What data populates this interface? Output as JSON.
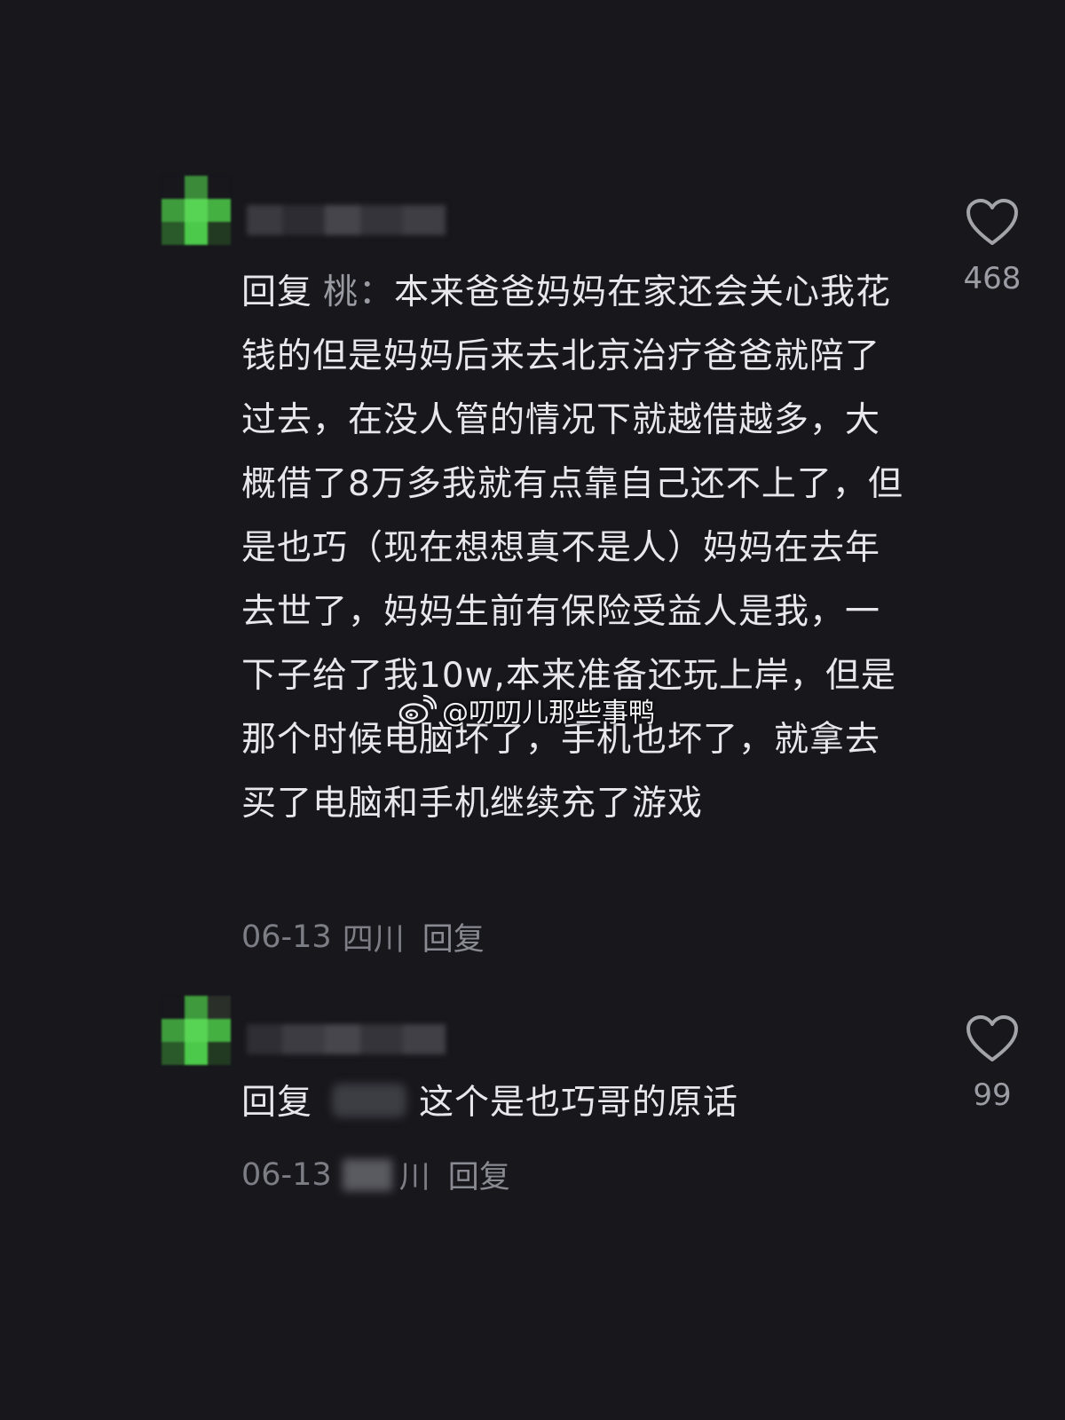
{
  "comments": [
    {
      "reply_prefix": "回复",
      "reply_target": "桃：",
      "text": "本来爸爸妈妈在家还会关心我花钱的但是妈妈后来去北京治疗爸爸就陪了过去，在没人管的情况下就越借越多，大概借了8万多我就有点靠自己还不上了，但是也巧（现在想想真不是人）妈妈在去年去世了，妈妈生前有保险受益人是我，一下子给了我10w,本来准备还玩上岸，但是那个时候电脑坏了，手机也坏了，就拿去买了电脑和手机继续充了游戏",
      "date": "06-13",
      "region": "四川",
      "reply_label": "回复",
      "like_count": "468"
    },
    {
      "reply_prefix": "回复",
      "text": "这个是也巧哥的原话",
      "date": "06-13",
      "region_tail": "川",
      "reply_label": "回复",
      "like_count": "99"
    }
  ],
  "watermark": {
    "text": "@叨叨儿那些事鸭",
    "icon": "weibo-icon"
  },
  "colors": {
    "background": "#17171c",
    "avatar_green": "#4cc84a"
  }
}
